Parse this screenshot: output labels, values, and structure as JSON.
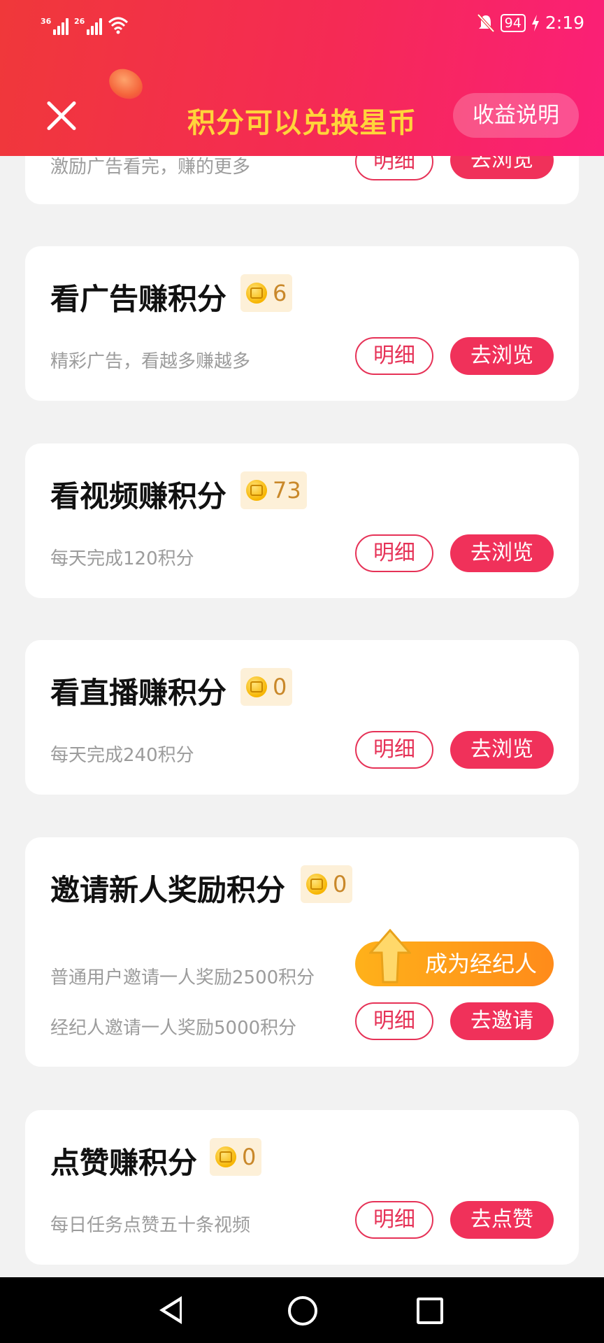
{
  "status_bar": {
    "net1": "36",
    "net2": "26",
    "battery": "94",
    "time": "2:19"
  },
  "header": {
    "title": "积分可以兑换星币",
    "explain_label": "收益说明"
  },
  "cards": [
    {
      "desc": "激励广告看完，赚的更多",
      "detail_label": "明细",
      "action_label": "去浏览"
    },
    {
      "title": "看广告赚积分",
      "points": "6",
      "desc": "精彩广告，看越多赚越多",
      "detail_label": "明细",
      "action_label": "去浏览"
    },
    {
      "title": "看视频赚积分",
      "points": "73",
      "desc": "每天完成120积分",
      "detail_label": "明细",
      "action_label": "去浏览"
    },
    {
      "title": "看直播赚积分",
      "points": "0",
      "desc": "每天完成240积分",
      "detail_label": "明细",
      "action_label": "去浏览"
    },
    {
      "title": "邀请新人奖励积分",
      "points": "0",
      "desc": "普通用户邀请一人奖励2500积分",
      "desc2": "经纪人邀请一人奖励5000积分",
      "agent_label": "成为经纪人",
      "detail_label": "明细",
      "action_label": "去邀请"
    },
    {
      "title": "点赞赚积分",
      "points": "0",
      "desc": "每日任务点赞五十条视频",
      "detail_label": "明细",
      "action_label": "去点赞"
    }
  ],
  "colors": {
    "accent": "#f0315a",
    "title_yellow": "#ffd43b",
    "badge_bg": "#fdf0d8"
  }
}
